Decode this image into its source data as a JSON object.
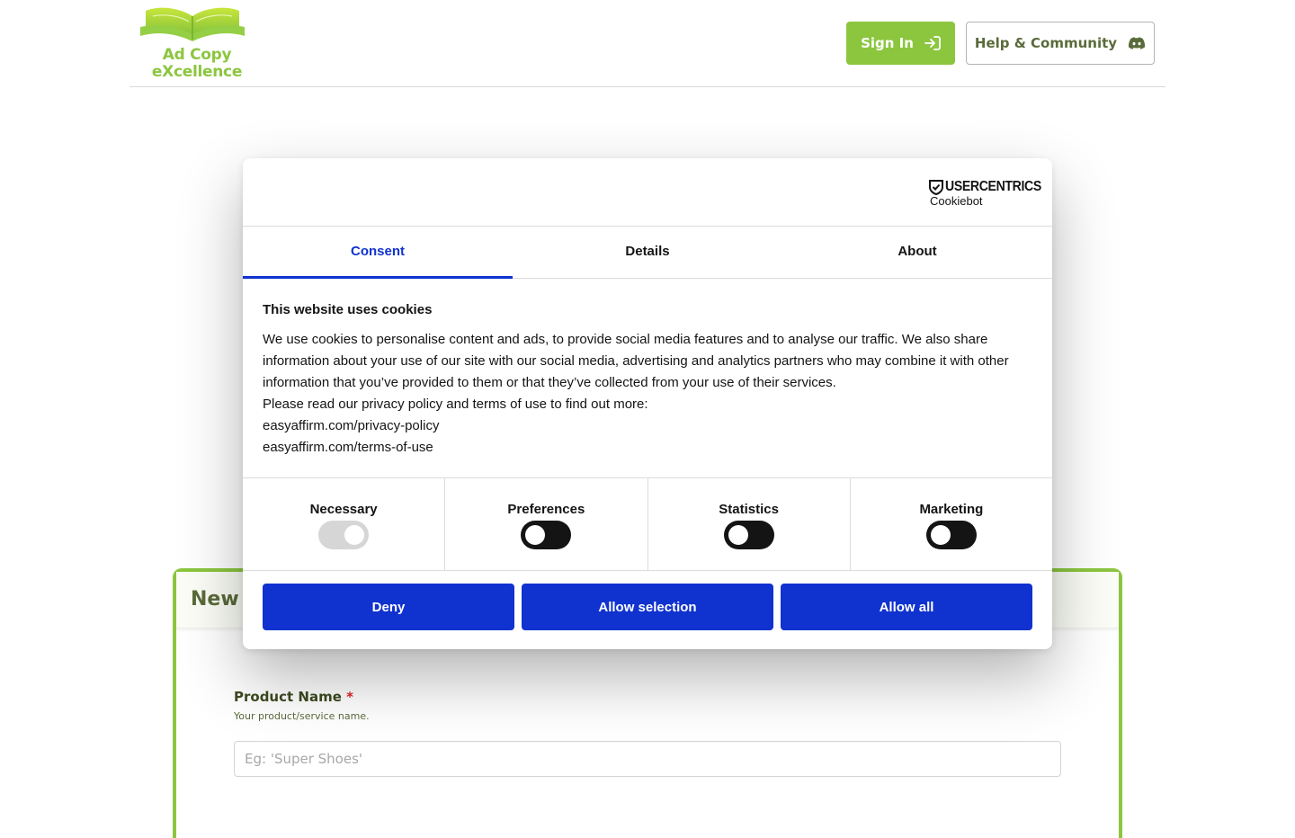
{
  "header": {
    "logo_line1": "Ad Copy",
    "logo_line2": "eXcellence",
    "signin_label": "Sign In",
    "help_label": "Help & Community",
    "signin_icon": "sign-in-icon",
    "help_icon": "discord-icon"
  },
  "form": {
    "title": "New A",
    "product_name_label": "Product Name",
    "required_marker": "*",
    "product_name_help": "Your product/service name.",
    "product_name_placeholder": "Eg: 'Super Shoes'",
    "product_name_value": ""
  },
  "cookie_dialog": {
    "brand": "USERCENTRICS",
    "brand_sub": "Cookiebot",
    "tabs": [
      {
        "label": "Consent",
        "active": true
      },
      {
        "label": "Details",
        "active": false
      },
      {
        "label": "About",
        "active": false
      }
    ],
    "heading": "This website uses cookies",
    "paragraph": "We use cookies to personalise content and ads, to provide social media features and to analyse our traffic. We also share information about your use of our site with our social media, advertising and analytics partners who may combine it with other information that you’ve provided to them or that they’ve collected from your use of their services.",
    "read_more": "Please read our privacy policy and terms of use to find out more:",
    "link_privacy": "easyaffirm.com/privacy-policy",
    "link_terms": "easyaffirm.com/terms-of-use",
    "categories": [
      {
        "label": "Necessary",
        "enabled": true,
        "locked": true
      },
      {
        "label": "Preferences",
        "enabled": false,
        "locked": false
      },
      {
        "label": "Statistics",
        "enabled": false,
        "locked": false
      },
      {
        "label": "Marketing",
        "enabled": false,
        "locked": false
      }
    ],
    "buttons": {
      "deny": "Deny",
      "allow_selection": "Allow selection",
      "allow_all": "Allow all"
    }
  },
  "colors": {
    "brand_green": "#8cc63f",
    "dark_green": "#5a6b3a",
    "cookie_blue": "#1032cf",
    "toggle_off": "#141414",
    "toggle_locked": "#d6d6d6"
  }
}
